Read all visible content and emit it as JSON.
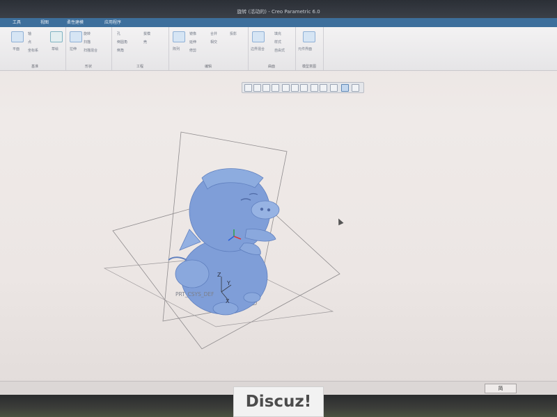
{
  "window": {
    "title": "旋转 (活动的) - Creo Parametric 6.0"
  },
  "tabs": [
    "工具",
    "视图",
    "柔性建模",
    "应用程序"
  ],
  "ribbon": {
    "groups": [
      {
        "label": "基准",
        "items": [
          "轴",
          "点",
          "坐标系",
          "平面",
          "草绘"
        ]
      },
      {
        "label": "形状",
        "items": [
          "拉伸",
          "旋转",
          "扫描",
          "扫描混合"
        ]
      },
      {
        "label": "工程",
        "items": [
          "孔",
          "倒圆角",
          "倒角",
          "拔模",
          "壳"
        ]
      },
      {
        "label": "编辑",
        "items": [
          "阵列",
          "镜像",
          "延伸",
          "修剪",
          "合并",
          "相交",
          "投影"
        ]
      },
      {
        "label": "曲面",
        "items": [
          "边界混合",
          "填充",
          "样式",
          "自由式"
        ]
      },
      {
        "label": "模型意图",
        "items": [
          "元件界面"
        ]
      }
    ]
  },
  "viewport": {
    "csys_label": "PRT_CSYS_DEF",
    "axes": {
      "x": "X",
      "y": "Y",
      "z": "Z"
    }
  },
  "statusbar": {
    "ime": "简"
  },
  "watermark": {
    "text": "Discuz!"
  },
  "colors": {
    "tabbar": "#3d6f9c",
    "model": "#7f9ed8",
    "background": "#ece6e4"
  }
}
